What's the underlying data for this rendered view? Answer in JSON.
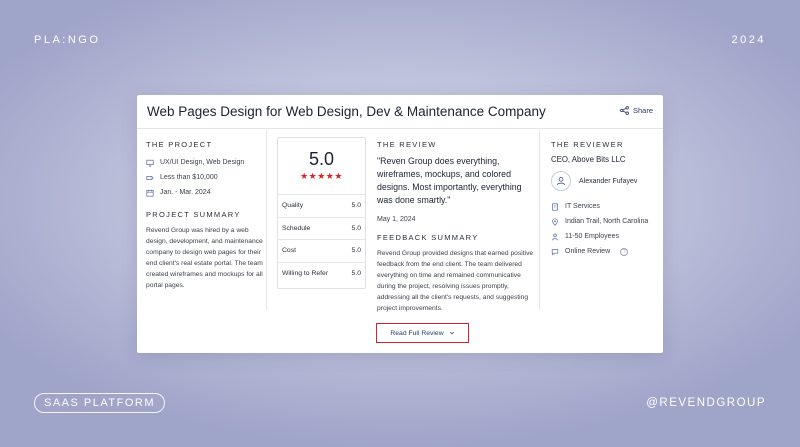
{
  "page": {
    "brand": "PLA:NGO",
    "year": "2024",
    "pill": "SAAS PLATFORM",
    "handle": "@REVENDGROUP"
  },
  "card": {
    "title": "Web Pages Design for Web Design, Dev & Maintenance Company",
    "share_label": "Share",
    "project": {
      "heading": "THE PROJECT",
      "service": "UX/UI Design, Web Design",
      "budget": "Less than $10,000",
      "dates": "Jan. - Mar. 2024"
    },
    "summary": {
      "heading": "PROJECT SUMMARY",
      "text": "Revend Group was hired by a web design, development, and maintenance company to design web pages for their end client's real estate portal. The team created wireframes and mockups for all portal pages."
    },
    "rating": {
      "overall": "5.0",
      "stars": "★★★★★",
      "metrics": [
        {
          "label": "Quality",
          "value": "5.0"
        },
        {
          "label": "Schedule",
          "value": "5.0"
        },
        {
          "label": "Cost",
          "value": "5.0"
        },
        {
          "label": "Willing to Refer",
          "value": "5.0"
        }
      ]
    },
    "review": {
      "heading": "THE REVIEW",
      "quote": "\"Reven Group does everything, wireframes, mockups, and colored designs. Most importantly, everything was done smartly.\"",
      "date": "May 1, 2024",
      "feedback_heading": "FEEDBACK SUMMARY",
      "feedback": "Revend Group provided designs that earned positive feedback from the end client. The team delivered everything on time and remained communicative during the project, resolving issues promptly, addressing all the client's requests, and suggesting project improvements."
    },
    "reviewer": {
      "heading": "THE REVIEWER",
      "role": "CEO, Above Bits LLC",
      "name": "Alexander Fufayev",
      "industry": "IT Services",
      "location": "Indian Trail, North Carolina",
      "size": "11-50 Employees",
      "source": "Online Review",
      "help": "?"
    },
    "cta": "Read Full Review"
  },
  "colors": {
    "accent": "#d6232a",
    "link": "#2b3a67",
    "icon": "#5a6a9a"
  }
}
